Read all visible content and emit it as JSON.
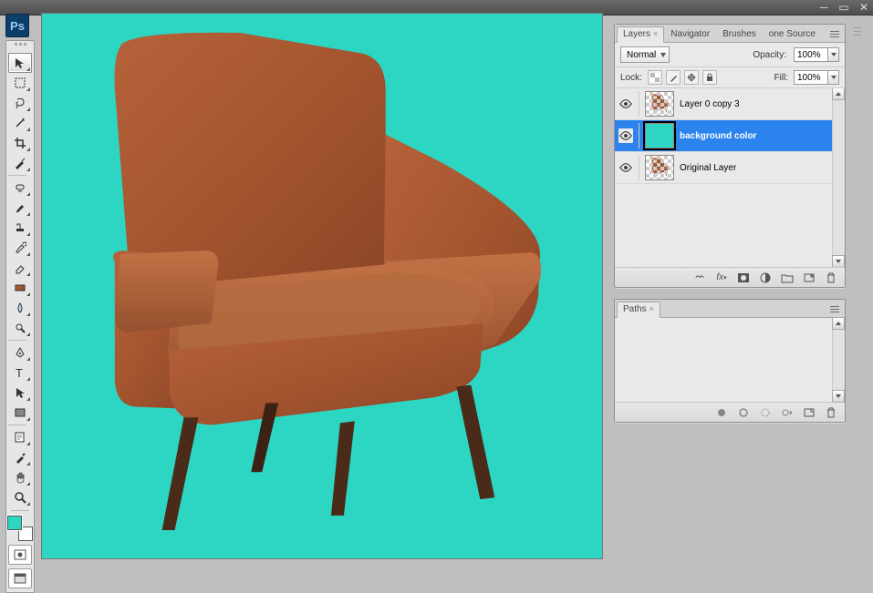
{
  "app": {
    "logo_text": "Ps"
  },
  "canvas": {
    "bg_color": "#2DD6C2"
  },
  "toolbox": {
    "tools": [
      {
        "name": "move-tool",
        "active": true
      },
      {
        "name": "marquee-tool"
      },
      {
        "name": "lasso-tool"
      },
      {
        "name": "magic-wand-tool"
      },
      {
        "name": "crop-tool"
      },
      {
        "name": "slice-tool"
      },
      {
        "name": "healing-brush-tool",
        "sep_before": true
      },
      {
        "name": "brush-tool"
      },
      {
        "name": "clone-stamp-tool"
      },
      {
        "name": "history-brush-tool"
      },
      {
        "name": "eraser-tool"
      },
      {
        "name": "gradient-tool"
      },
      {
        "name": "blur-tool"
      },
      {
        "name": "dodge-tool"
      },
      {
        "name": "pen-tool",
        "sep_before": true
      },
      {
        "name": "type-tool"
      },
      {
        "name": "path-selection-tool"
      },
      {
        "name": "rectangle-tool"
      },
      {
        "name": "notes-tool",
        "sep_before": true
      },
      {
        "name": "eyedropper-tool"
      },
      {
        "name": "hand-tool"
      },
      {
        "name": "zoom-tool"
      }
    ],
    "fg_color": "#2DD6C2",
    "bg_color": "#FFFFFF"
  },
  "layers_panel": {
    "tabs": [
      "Layers",
      "Navigator",
      "Brushes",
      "one Source"
    ],
    "active_tab": 0,
    "blend_mode": "Normal",
    "opacity_label": "Opacity:",
    "opacity_value": "100%",
    "lock_label": "Lock:",
    "fill_label": "Fill:",
    "fill_value": "100%",
    "layers": [
      {
        "name": "Layer 0 copy 3",
        "visible": true,
        "thumb": "chair",
        "selected": false
      },
      {
        "name": "background color",
        "visible": true,
        "thumb": "solid_teal",
        "selected": true,
        "bold": true
      },
      {
        "name": "Original Layer",
        "visible": true,
        "thumb": "chair",
        "selected": false
      }
    ],
    "footer_icons": [
      "link-icon",
      "fx-icon",
      "mask-icon",
      "adjustment-icon",
      "group-icon",
      "new-layer-icon",
      "trash-icon"
    ]
  },
  "paths_panel": {
    "tab": "Paths",
    "footer_icons": [
      "fill-path-icon",
      "stroke-path-icon",
      "selection-from-path-icon",
      "path-from-selection-icon",
      "new-path-icon",
      "trash-icon"
    ]
  }
}
